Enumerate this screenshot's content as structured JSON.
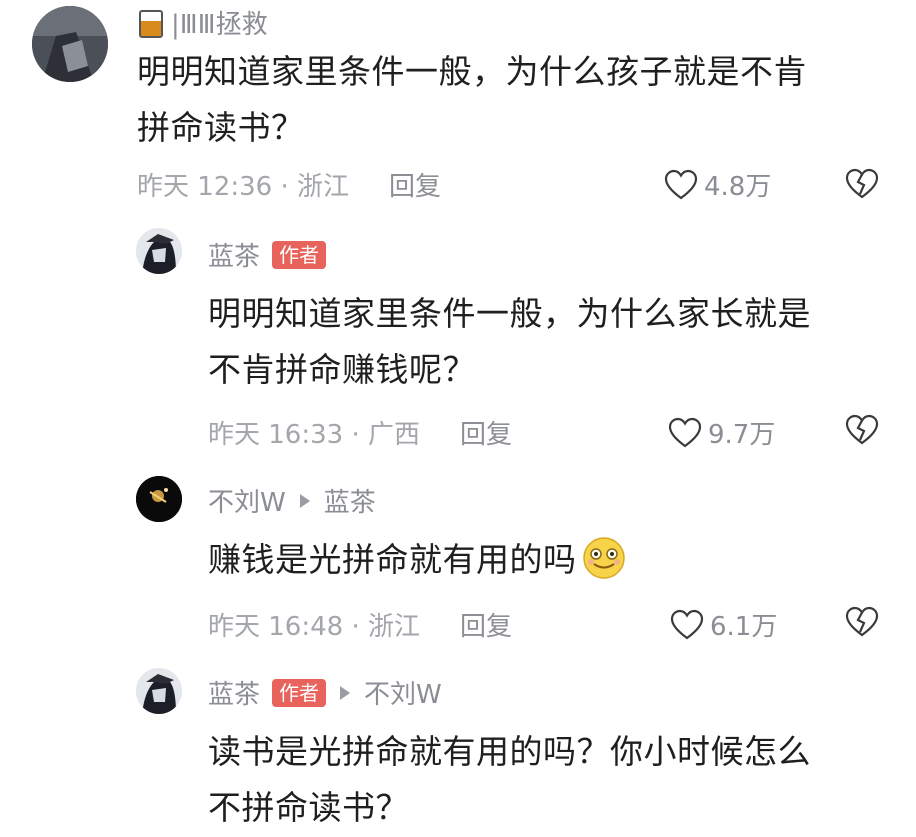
{
  "comments": [
    {
      "username": "|ⅢⅢ拯救",
      "text_lines": [
        "明明知道家里条件一般，为什么孩子就是不肯",
        "拼命读书？"
      ],
      "time": "昨天 12:36 · 浙江",
      "reply": "回复",
      "likes": "4.8万"
    },
    {
      "username": "蓝茶",
      "author_tag": "作者",
      "text_lines": [
        "明明知道家里条件一般，为什么家长就是",
        "不肯拼命赚钱呢？"
      ],
      "time": "昨天 16:33 · 广西",
      "reply": "回复",
      "likes": "9.7万"
    },
    {
      "username": "不刘W",
      "reply_to": "蓝茶",
      "text_lines": [
        "赚钱是光拼命就有用的吗"
      ],
      "time": "昨天 16:48 · 浙江",
      "reply": "回复",
      "likes": "6.1万"
    },
    {
      "username": "蓝茶",
      "author_tag": "作者",
      "reply_to": "不刘W",
      "text_lines": [
        "读书是光拼命就有用的吗？你小时候怎么",
        "不拼命读书？"
      ]
    }
  ],
  "icons": {
    "like": "heart-outline-icon",
    "dislike": "broken-heart-icon",
    "emoji": "smiling-face-icon",
    "username_prefix": "glass-icon"
  },
  "colors": {
    "author_tag_bg": "#e8635b",
    "meta_text": "#a3a6ab",
    "name_text": "#8a8d93"
  }
}
